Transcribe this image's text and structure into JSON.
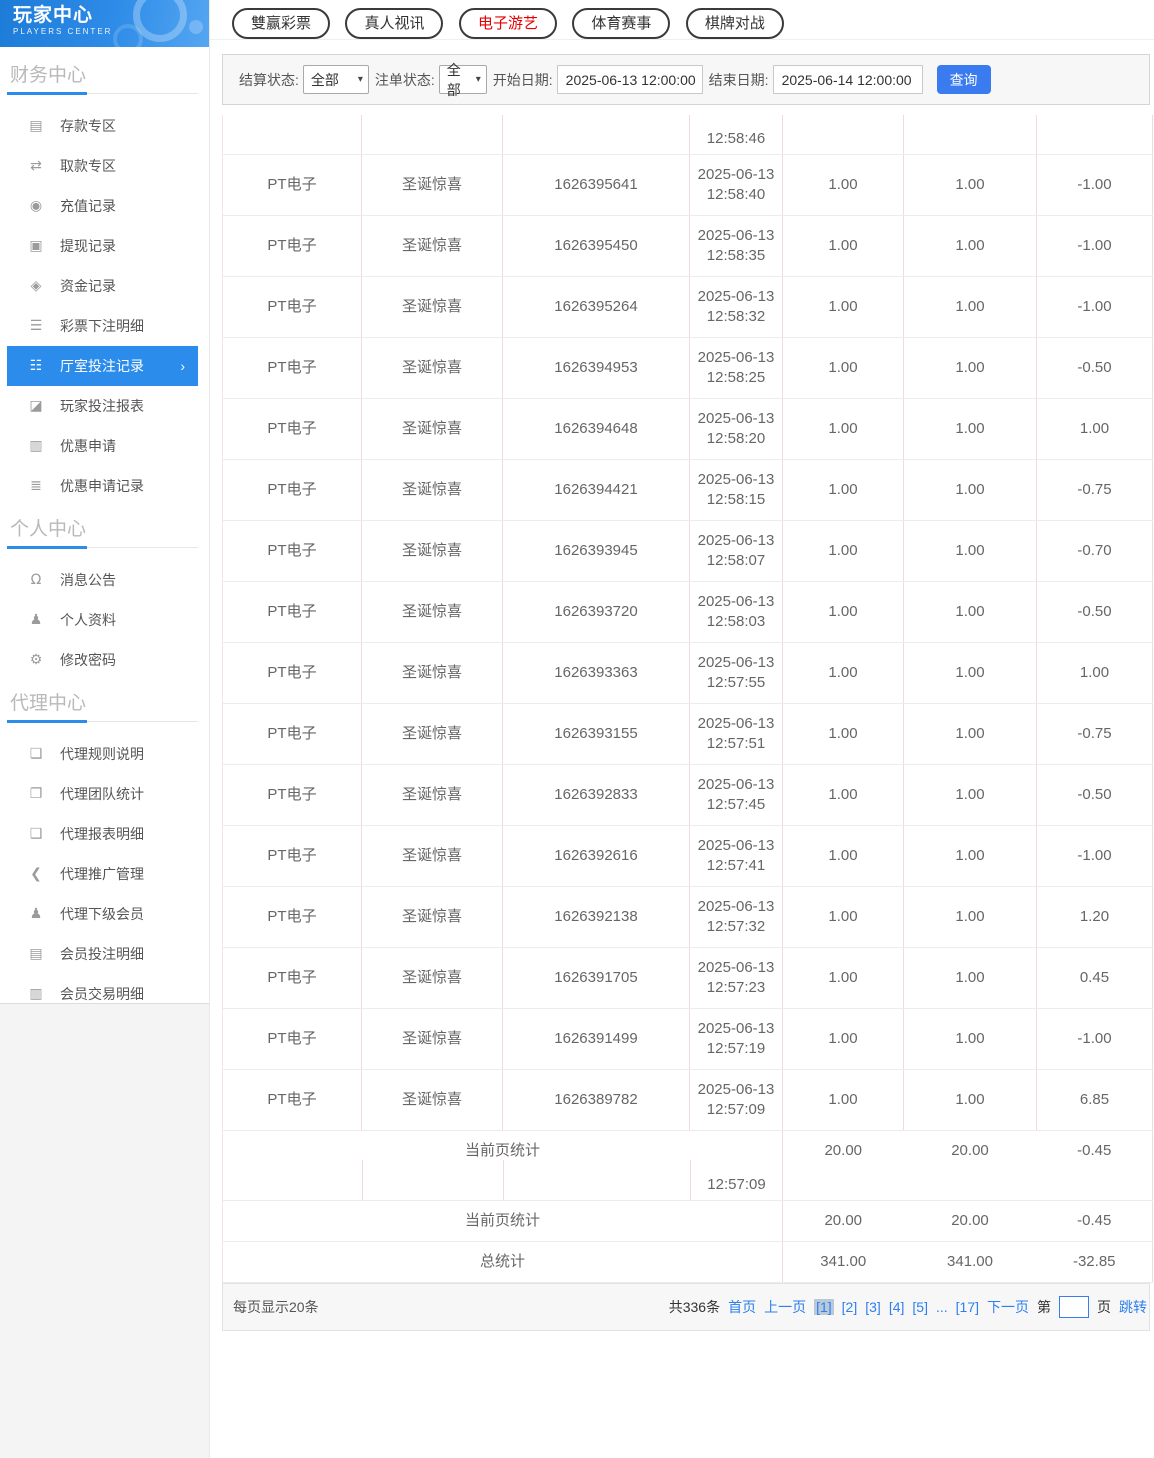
{
  "icons": {
    "chevron_right": "›",
    "chevron_down": "▾"
  },
  "sidebar": {
    "title": "玩家中心",
    "subtitle": "PLAYERS CENTER",
    "sections": [
      {
        "label": "财务中心",
        "items": [
          {
            "name": "sidebar-item-deposit",
            "icon": "deposit-card-icon",
            "glyph": "▤",
            "label": "存款专区"
          },
          {
            "name": "sidebar-item-withdraw",
            "icon": "withdraw-hand-icon",
            "glyph": "⇄",
            "label": "取款专区"
          },
          {
            "name": "sidebar-item-recharge-records",
            "icon": "money-bag-icon",
            "glyph": "◉",
            "label": "充值记录"
          },
          {
            "name": "sidebar-item-withdrawal-records",
            "icon": "wallet-icon",
            "glyph": "▣",
            "label": "提现记录"
          },
          {
            "name": "sidebar-item-funds-records",
            "icon": "purse-icon",
            "glyph": "◈",
            "label": "资金记录"
          },
          {
            "name": "sidebar-item-lottery-bet-details",
            "icon": "list-icon",
            "glyph": "☰",
            "label": "彩票下注明细"
          },
          {
            "name": "sidebar-item-hall-bet-records",
            "icon": "grid-list-icon",
            "glyph": "☷",
            "label": "厅室投注记录",
            "active": true
          },
          {
            "name": "sidebar-item-player-bet-report",
            "icon": "chart-report-icon",
            "glyph": "◪",
            "label": "玩家投注报表"
          },
          {
            "name": "sidebar-item-promo-apply",
            "icon": "ticket-icon",
            "glyph": "▥",
            "label": "优惠申请"
          },
          {
            "name": "sidebar-item-promo-apply-records",
            "icon": "record-list-icon",
            "glyph": "≣",
            "label": "优惠申请记录"
          }
        ]
      },
      {
        "label": "个人中心",
        "items": [
          {
            "name": "sidebar-item-announcements",
            "icon": "bell-icon",
            "glyph": "Ω",
            "label": "消息公告"
          },
          {
            "name": "sidebar-item-profile",
            "icon": "user-icon",
            "glyph": "♟",
            "label": "个人资料"
          },
          {
            "name": "sidebar-item-change-password",
            "icon": "gear-icon",
            "glyph": "⚙",
            "label": "修改密码"
          }
        ]
      },
      {
        "label": "代理中心",
        "items": [
          {
            "name": "sidebar-item-agent-rules",
            "icon": "document-icon",
            "glyph": "❏",
            "label": "代理规则说明"
          },
          {
            "name": "sidebar-item-agent-team-stats",
            "icon": "report-icon",
            "glyph": "❐",
            "label": "代理团队统计"
          },
          {
            "name": "sidebar-item-agent-report-details",
            "icon": "report-detail-icon",
            "glyph": "❑",
            "label": "代理报表明细"
          },
          {
            "name": "sidebar-item-agent-promotion",
            "icon": "share-icon",
            "glyph": "❮",
            "label": "代理推广管理"
          },
          {
            "name": "sidebar-item-agent-members",
            "icon": "users-icon",
            "glyph": "♟",
            "label": "代理下级会员"
          },
          {
            "name": "sidebar-item-member-bet-details",
            "icon": "clipboard-icon",
            "glyph": "▤",
            "label": "会员投注明细"
          },
          {
            "name": "sidebar-item-member-transaction-details",
            "icon": "transaction-list-icon",
            "glyph": "▥",
            "label": "会员交易明细"
          }
        ]
      }
    ]
  },
  "topnav": {
    "tabs": [
      {
        "name": "tab-double-win-lottery",
        "label": "雙赢彩票"
      },
      {
        "name": "tab-live-video",
        "label": "真人视讯"
      },
      {
        "name": "tab-electronic-games",
        "label": "电子游艺",
        "active": true
      },
      {
        "name": "tab-sports-events",
        "label": "体育赛事"
      },
      {
        "name": "tab-board-games",
        "label": "棋牌对战"
      }
    ]
  },
  "filters": {
    "settle_status_label": "结算状态:",
    "settle_status_value": "全部",
    "order_status_label": "注单状态:",
    "order_status_value": "全部",
    "start_date_label": "开始日期:",
    "start_date_value": "2025-06-13 12:00:00",
    "end_date_label": "结束日期:",
    "end_date_value": "2025-06-14 12:00:00",
    "search_label": "查询"
  },
  "table": {
    "partial_top_time": "12:58:46",
    "rows": [
      {
        "provider": "PT电子",
        "game": "圣诞惊喜",
        "order_id": "1626395641",
        "date": "2025-06-13",
        "time": "12:58:40",
        "bet": "1.00",
        "valid": "1.00",
        "result": "-1.00"
      },
      {
        "provider": "PT电子",
        "game": "圣诞惊喜",
        "order_id": "1626395450",
        "date": "2025-06-13",
        "time": "12:58:35",
        "bet": "1.00",
        "valid": "1.00",
        "result": "-1.00"
      },
      {
        "provider": "PT电子",
        "game": "圣诞惊喜",
        "order_id": "1626395264",
        "date": "2025-06-13",
        "time": "12:58:32",
        "bet": "1.00",
        "valid": "1.00",
        "result": "-1.00"
      },
      {
        "provider": "PT电子",
        "game": "圣诞惊喜",
        "order_id": "1626394953",
        "date": "2025-06-13",
        "time": "12:58:25",
        "bet": "1.00",
        "valid": "1.00",
        "result": "-0.50"
      },
      {
        "provider": "PT电子",
        "game": "圣诞惊喜",
        "order_id": "1626394648",
        "date": "2025-06-13",
        "time": "12:58:20",
        "bet": "1.00",
        "valid": "1.00",
        "result": "1.00"
      },
      {
        "provider": "PT电子",
        "game": "圣诞惊喜",
        "order_id": "1626394421",
        "date": "2025-06-13",
        "time": "12:58:15",
        "bet": "1.00",
        "valid": "1.00",
        "result": "-0.75"
      },
      {
        "provider": "PT电子",
        "game": "圣诞惊喜",
        "order_id": "1626393945",
        "date": "2025-06-13",
        "time": "12:58:07",
        "bet": "1.00",
        "valid": "1.00",
        "result": "-0.70"
      },
      {
        "provider": "PT电子",
        "game": "圣诞惊喜",
        "order_id": "1626393720",
        "date": "2025-06-13",
        "time": "12:58:03",
        "bet": "1.00",
        "valid": "1.00",
        "result": "-0.50"
      },
      {
        "provider": "PT电子",
        "game": "圣诞惊喜",
        "order_id": "1626393363",
        "date": "2025-06-13",
        "time": "12:57:55",
        "bet": "1.00",
        "valid": "1.00",
        "result": "1.00"
      },
      {
        "provider": "PT电子",
        "game": "圣诞惊喜",
        "order_id": "1626393155",
        "date": "2025-06-13",
        "time": "12:57:51",
        "bet": "1.00",
        "valid": "1.00",
        "result": "-0.75"
      },
      {
        "provider": "PT电子",
        "game": "圣诞惊喜",
        "order_id": "1626392833",
        "date": "2025-06-13",
        "time": "12:57:45",
        "bet": "1.00",
        "valid": "1.00",
        "result": "-0.50"
      },
      {
        "provider": "PT电子",
        "game": "圣诞惊喜",
        "order_id": "1626392616",
        "date": "2025-06-13",
        "time": "12:57:41",
        "bet": "1.00",
        "valid": "1.00",
        "result": "-1.00"
      },
      {
        "provider": "PT电子",
        "game": "圣诞惊喜",
        "order_id": "1626392138",
        "date": "2025-06-13",
        "time": "12:57:32",
        "bet": "1.00",
        "valid": "1.00",
        "result": "1.20"
      },
      {
        "provider": "PT电子",
        "game": "圣诞惊喜",
        "order_id": "1626391705",
        "date": "2025-06-13",
        "time": "12:57:23",
        "bet": "1.00",
        "valid": "1.00",
        "result": "0.45"
      },
      {
        "provider": "PT电子",
        "game": "圣诞惊喜",
        "order_id": "1626391499",
        "date": "2025-06-13",
        "time": "12:57:19",
        "bet": "1.00",
        "valid": "1.00",
        "result": "-1.00"
      },
      {
        "provider": "PT电子",
        "game": "圣诞惊喜",
        "order_id": "1626389782",
        "date": "2025-06-13",
        "time": "12:57:09",
        "bet": "1.00",
        "valid": "1.00",
        "result": "6.85"
      }
    ],
    "page_summary_label": "当前页统计",
    "glitch_time": "12:57:09",
    "page_summary": {
      "bet": "20.00",
      "valid": "20.00",
      "result": "-0.45"
    },
    "total_label": "总统计",
    "total": {
      "bet": "341.00",
      "valid": "341.00",
      "result": "-32.85"
    }
  },
  "pagination": {
    "per_page": "每页显示20条",
    "total_count": "共336条",
    "first": "首页",
    "prev": "上一页",
    "pages": [
      {
        "label": "[1]",
        "active": true
      },
      {
        "label": "[2]"
      },
      {
        "label": "[3]"
      },
      {
        "label": "[4]"
      },
      {
        "label": "[5]"
      },
      {
        "label": "..."
      },
      {
        "label": "[17]"
      }
    ],
    "next": "下一页",
    "jump_prefix": "第",
    "jump_suffix": "页",
    "jump_action": "跳转"
  }
}
